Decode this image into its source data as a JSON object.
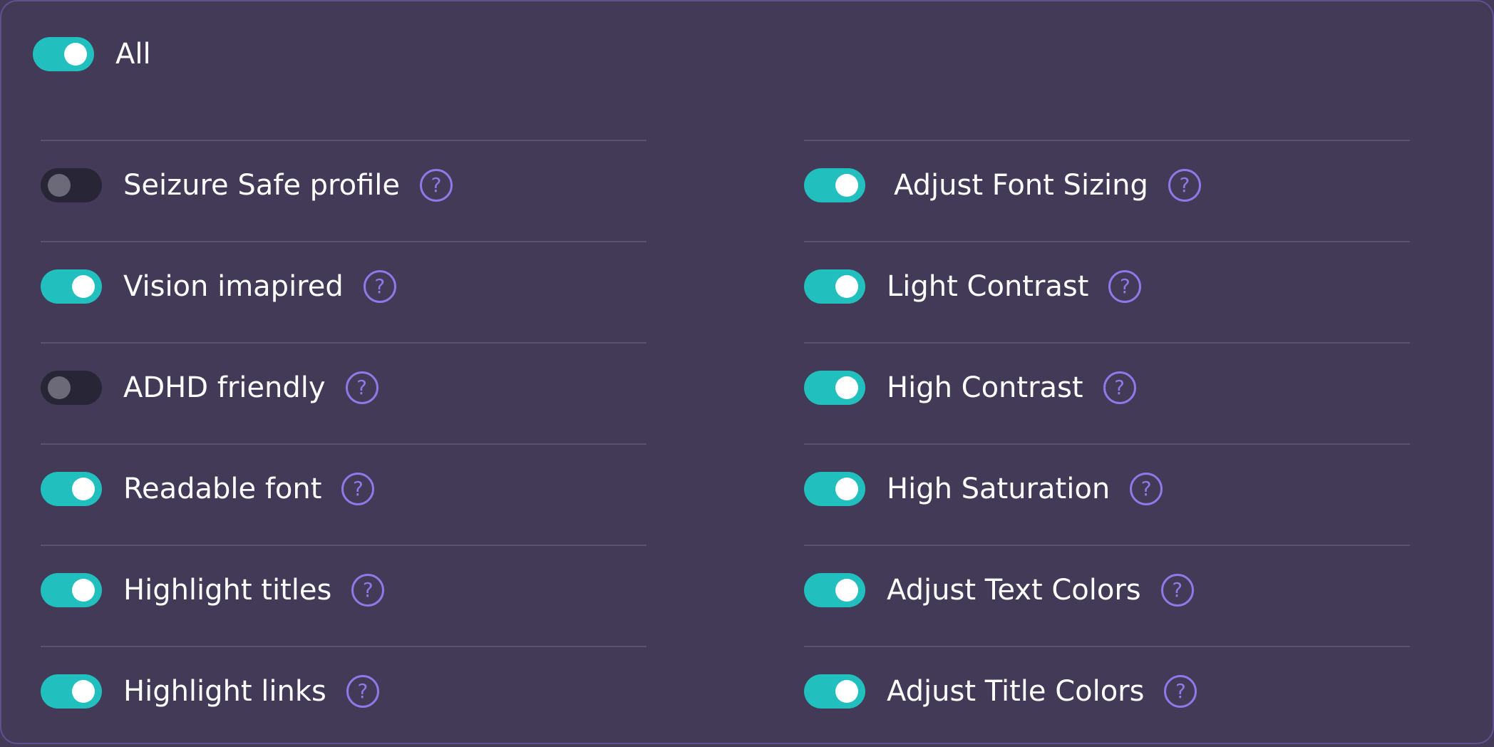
{
  "all": {
    "label": "All",
    "enabled": true
  },
  "help_glyph": "?",
  "left": [
    {
      "label": "Seizure Safe profile",
      "enabled": false
    },
    {
      "label": "Vision imapired",
      "enabled": true
    },
    {
      "label": "ADHD friendly",
      "enabled": false
    },
    {
      "label": "Readable font",
      "enabled": true
    },
    {
      "label": "Highlight titles",
      "enabled": true
    },
    {
      "label": "Highlight links",
      "enabled": true
    }
  ],
  "right": [
    {
      "label": "Adjust Font Sizing",
      "enabled": true
    },
    {
      "label": "Light Contrast",
      "enabled": true
    },
    {
      "label": "High Contrast",
      "enabled": true
    },
    {
      "label": "High Saturation",
      "enabled": true
    },
    {
      "label": "Adjust Text Colors",
      "enabled": true
    },
    {
      "label": "Adjust Title Colors",
      "enabled": true
    }
  ],
  "colors": {
    "background": "#433a58",
    "toggle_on": "#21bfbd",
    "toggle_off": "#282636",
    "help_icon": "#8f78e8"
  }
}
